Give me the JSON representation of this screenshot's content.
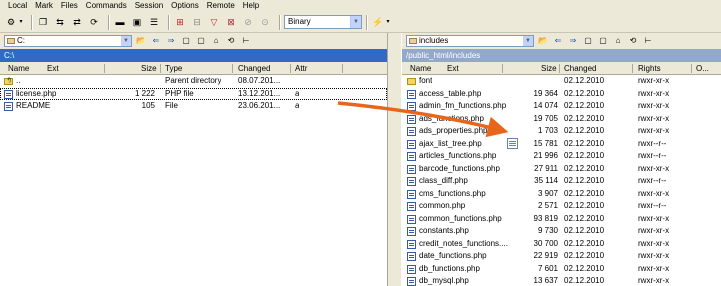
{
  "menu": [
    "Local",
    "Mark",
    "Files",
    "Commands",
    "Session",
    "Options",
    "Remote",
    "Help"
  ],
  "toolbar": {
    "transfer_mode": "Binary",
    "icons": [
      "preferences-icon",
      "copy-icon",
      "move-icon",
      "compare-icon",
      "synchronize-icon",
      "console-icon",
      "terminal-icon",
      "queue-icon",
      "plus-icon",
      "minus-icon",
      "filter-icon",
      "invert-selection-icon",
      "select-all-icon",
      "clear-icon",
      "session-icon"
    ]
  },
  "left": {
    "path": "C:",
    "title": "C:\\",
    "columns": [
      "Name",
      "Ext",
      "Size",
      "Type",
      "Changed",
      "Attr"
    ],
    "rows": [
      {
        "name": "..",
        "size": "",
        "type": "Parent directory",
        "changed": "08.07.201...",
        "attr": "",
        "icon": "up-folder"
      },
      {
        "name": "license.php",
        "size": "1 222",
        "type": "PHP file",
        "changed": "13.12.201...",
        "attr": "a",
        "icon": "file"
      },
      {
        "name": "README",
        "size": "105",
        "type": "File",
        "changed": "23.06.201...",
        "attr": "a",
        "icon": "file"
      }
    ]
  },
  "right": {
    "path": "includes",
    "title": "/public_html/includes",
    "columns": [
      "Name",
      "Ext",
      "Size",
      "Changed",
      "Rights",
      "O..."
    ],
    "rows": [
      {
        "name": "font",
        "size": "",
        "changed": "02.12.2010",
        "rights": "rwxr-xr-x",
        "icon": "folder"
      },
      {
        "name": "access_table.php",
        "size": "19 364",
        "changed": "02.12.2010",
        "rights": "rwxr-xr-x",
        "icon": "file"
      },
      {
        "name": "admin_fm_functions.php",
        "size": "14 074",
        "changed": "02.12.2010",
        "rights": "rwxr-xr-x",
        "icon": "file"
      },
      {
        "name": "ads_functions.php",
        "size": "19 705",
        "changed": "02.12.2010",
        "rights": "rwxr-xr-x",
        "icon": "file"
      },
      {
        "name": "ads_properties.php",
        "size": "1 703",
        "changed": "02.12.2010",
        "rights": "rwxr-xr-x",
        "icon": "file"
      },
      {
        "name": "ajax_list_tree.php",
        "size": "15 781",
        "changed": "02.12.2010",
        "rights": "rwxr--r--",
        "icon": "file"
      },
      {
        "name": "articles_functions.php",
        "size": "21 996",
        "changed": "02.12.2010",
        "rights": "rwxr--r--",
        "icon": "file"
      },
      {
        "name": "barcode_functions.php",
        "size": "27 911",
        "changed": "02.12.2010",
        "rights": "rwxr-xr-x",
        "icon": "file"
      },
      {
        "name": "class_diff.php",
        "size": "35 114",
        "changed": "02.12.2010",
        "rights": "rwxr--r--",
        "icon": "file"
      },
      {
        "name": "cms_functions.php",
        "size": "3 907",
        "changed": "02.12.2010",
        "rights": "rwxr-xr-x",
        "icon": "file"
      },
      {
        "name": "common.php",
        "size": "2 571",
        "changed": "02.12.2010",
        "rights": "rwxr--r--",
        "icon": "file"
      },
      {
        "name": "common_functions.php",
        "size": "93 819",
        "changed": "02.12.2010",
        "rights": "rwxr-xr-x",
        "icon": "file"
      },
      {
        "name": "constants.php",
        "size": "9 730",
        "changed": "02.12.2010",
        "rights": "rwxr-xr-x",
        "icon": "file"
      },
      {
        "name": "credit_notes_functions....",
        "size": "30 700",
        "changed": "02.12.2010",
        "rights": "rwxr-xr-x",
        "icon": "file"
      },
      {
        "name": "date_functions.php",
        "size": "22 919",
        "changed": "02.12.2010",
        "rights": "rwxr-xr-x",
        "icon": "file"
      },
      {
        "name": "db_functions.php",
        "size": "7 601",
        "changed": "02.12.2010",
        "rights": "rwxr-xr-x",
        "icon": "file"
      },
      {
        "name": "db_mysql.php",
        "size": "13 637",
        "changed": "02.12.2010",
        "rights": "rwxr-xr-x",
        "icon": "file"
      }
    ]
  },
  "colors": {
    "drag_arrow": "#e8661c",
    "active_title": "#316ac5",
    "inactive_title": "#93a9c9"
  }
}
